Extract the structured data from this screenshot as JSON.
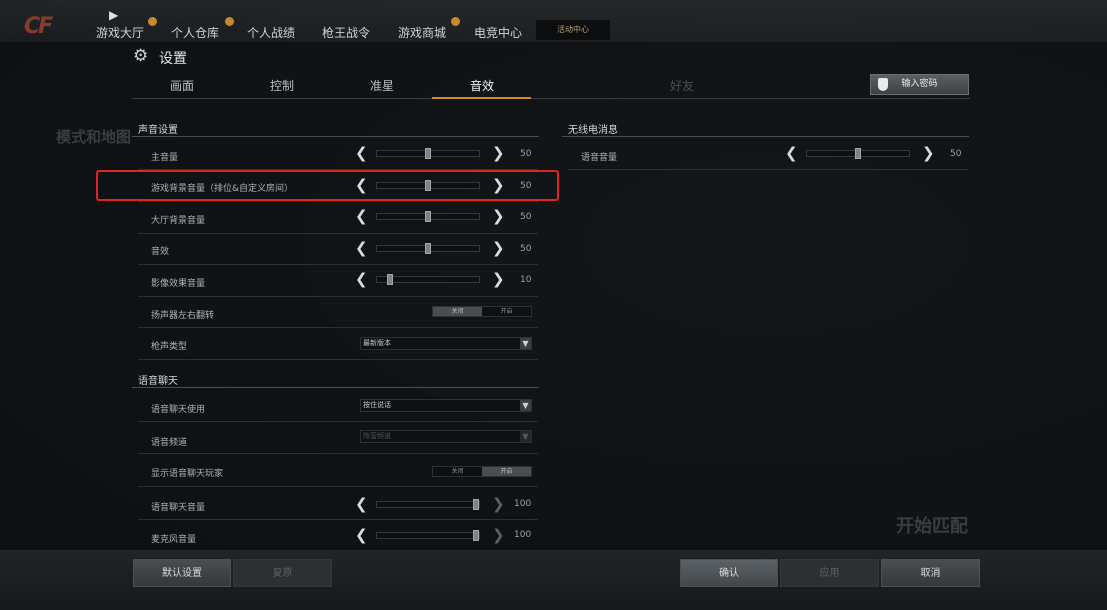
{
  "nav": {
    "items": [
      "游戏大厅",
      "个人仓库",
      "个人战绩",
      "枪王战令",
      "游戏商城",
      "电竞中心"
    ],
    "activity": "活动中心"
  },
  "background": {
    "mode_text": "模式和地图",
    "start_match": "开始匹配"
  },
  "dialog": {
    "title": "设置",
    "tabs": [
      "画面",
      "控制",
      "准星",
      "音效",
      "好友"
    ],
    "active_tab": "音效",
    "password_button": "输入密码",
    "sound": {
      "section_title": "声音设置",
      "master_volume": {
        "label": "主音量",
        "value": "50",
        "level": 0.5
      },
      "game_bg_volume": {
        "label": "游戏背景音量（排位&自定义房间）",
        "value": "50",
        "level": 0.5
      },
      "lobby_bg_volume": {
        "label": "大厅背景音量",
        "value": "50",
        "level": 0.5
      },
      "sfx_volume": {
        "label": "音效",
        "value": "50",
        "level": 0.5
      },
      "video_volume": {
        "label": "影像效果音量",
        "value": "10",
        "level": 0.1
      },
      "speaker_flip": {
        "label": "扬声器左右翻转",
        "off": "关闭",
        "on": "开启",
        "selected": "off"
      },
      "gunshot_type": {
        "label": "枪声类型",
        "value": "最新版本"
      }
    },
    "voice": {
      "section_title": "语音聊天",
      "usage": {
        "label": "语音聊天使用",
        "value": "按住说话"
      },
      "channel": {
        "label": "语音频道",
        "value": "阵营频道"
      },
      "show_players": {
        "label": "显示语音聊天玩家",
        "off": "关闭",
        "on": "开启",
        "selected": "on"
      },
      "chat_volume": {
        "label": "语音聊天音量",
        "value": "100",
        "level": 1.0
      },
      "mic_volume": {
        "label": "麦克风音量",
        "value": "100",
        "level": 1.0
      }
    },
    "radio": {
      "section_title": "无线电消息",
      "voice_volume": {
        "label": "语音音量",
        "value": "50",
        "level": 0.5
      }
    },
    "footer": {
      "default_button": "默认设置",
      "restore_button": "复原",
      "confirm_button": "确认",
      "apply_button": "应用",
      "cancel_button": "取消"
    }
  },
  "colors": {
    "accent": "#d08a2a",
    "highlight_box": "#e0251d"
  }
}
